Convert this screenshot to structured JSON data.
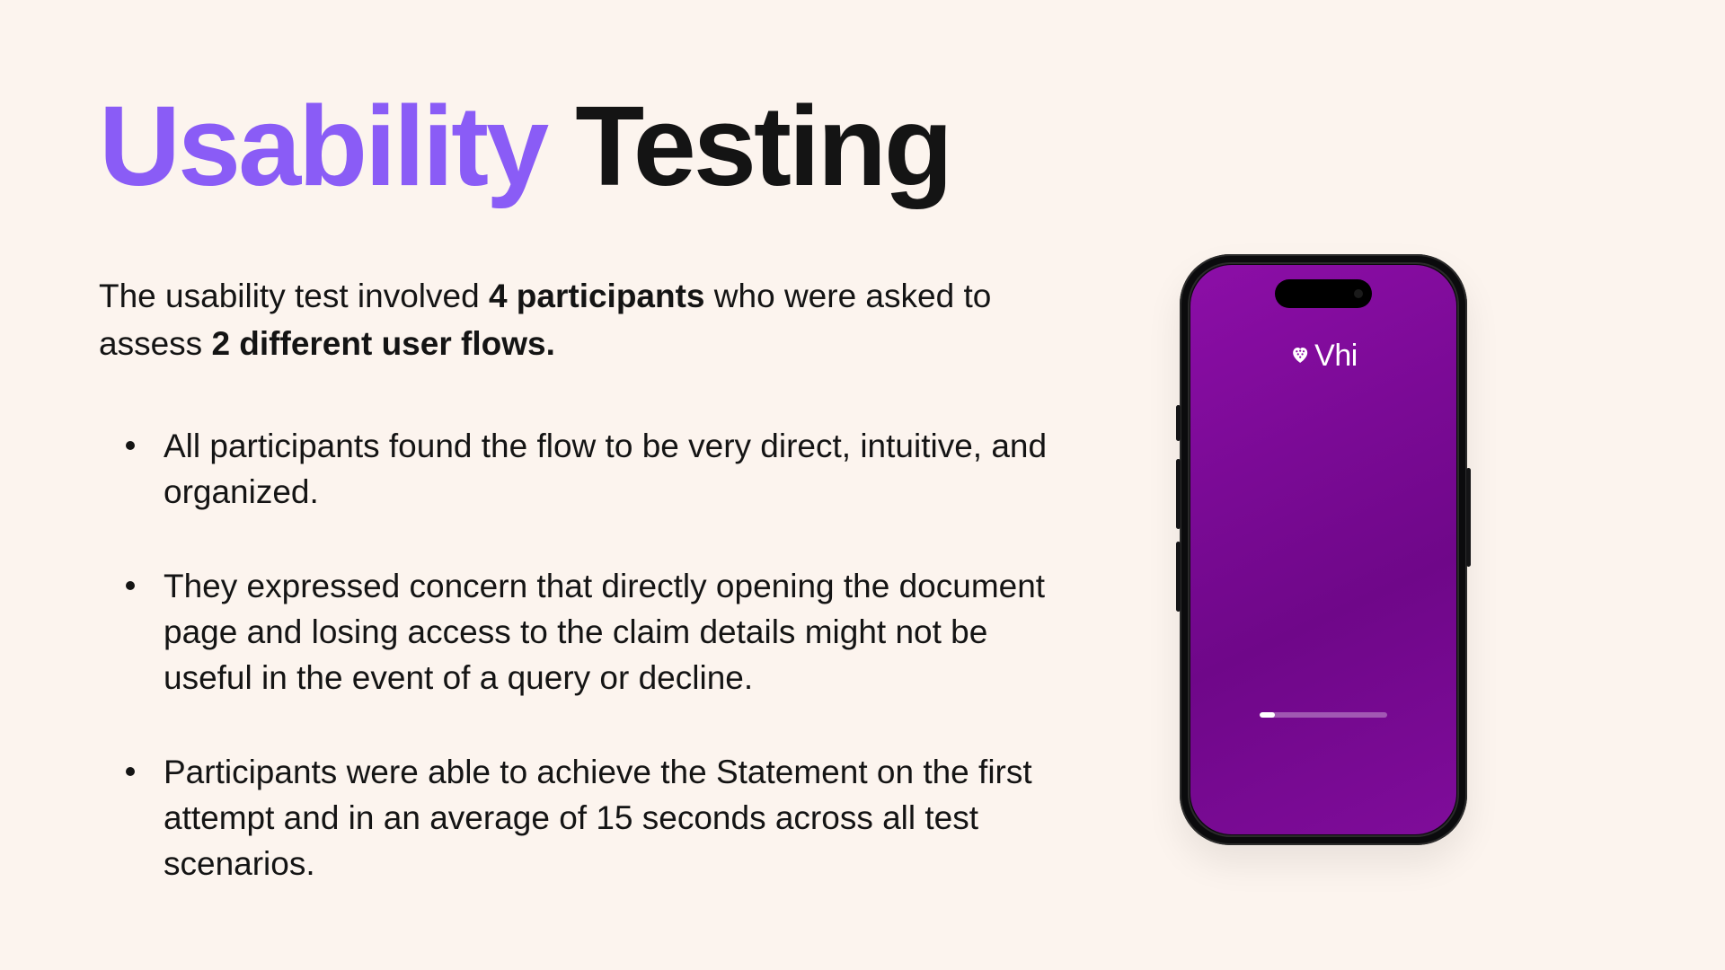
{
  "title": {
    "accent": "Usability",
    "rest": "Testing"
  },
  "intro": {
    "pre": "The usability test involved ",
    "b1": "4 participants",
    "mid": " who were asked to assess ",
    "b2": "2 different user flows."
  },
  "bullets": [
    "All participants found the flow to be very direct, intuitive, and organized.",
    "They expressed concern that directly opening the document page and losing access to the claim details might not be useful in the event of a query or decline.",
    "Participants were able to achieve the Statement on the first attempt and in an average of 15 seconds across all test scenarios."
  ],
  "phone": {
    "brand": "Vhi",
    "progress_percent": 12
  },
  "colors": {
    "background": "#fcf4ee",
    "accent": "#8a5cf6",
    "phone_gradient_top": "#8c0ea7",
    "phone_gradient_bottom": "#7f0c9a"
  }
}
